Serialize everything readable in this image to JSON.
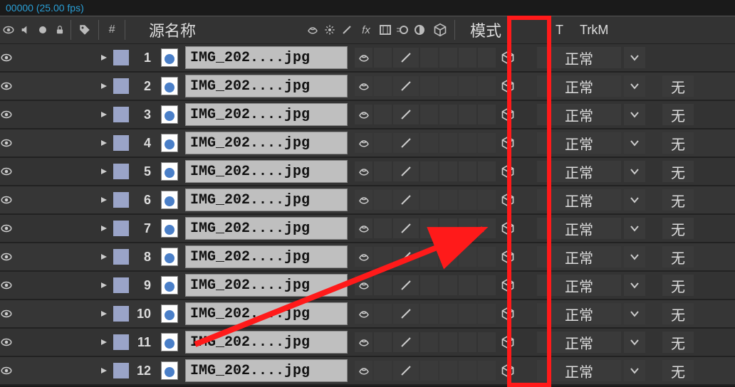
{
  "topbar": {
    "text": "00000 (25.00 fps)"
  },
  "header": {
    "source_name_label": "源名称",
    "mode_label": "模式",
    "t_label": "T",
    "trkmat_label": "TrkM"
  },
  "icons": {
    "eye": "eye-icon",
    "speaker": "speaker-icon",
    "solo": "solo-icon",
    "lock": "lock-icon",
    "label": "label-icon",
    "hash": "hash-icon",
    "shy": "shy-icon",
    "sun": "sun-icon",
    "slash": "slash-icon",
    "fx": "fx-icon",
    "frame": "frame-blend-icon",
    "mb": "motion-blur-icon",
    "adj": "adjustment-icon",
    "cube": "three-d-cube-icon",
    "chevdown": "chevron-down-icon",
    "triangle": "expand-triangle-icon"
  },
  "layers": [
    {
      "num": "1",
      "name": "IMG_202....jpg",
      "mode": "正常",
      "trk": ""
    },
    {
      "num": "2",
      "name": "IMG_202....jpg",
      "mode": "正常",
      "trk": "无"
    },
    {
      "num": "3",
      "name": "IMG_202....jpg",
      "mode": "正常",
      "trk": "无"
    },
    {
      "num": "4",
      "name": "IMG_202....jpg",
      "mode": "正常",
      "trk": "无"
    },
    {
      "num": "5",
      "name": "IMG_202....jpg",
      "mode": "正常",
      "trk": "无"
    },
    {
      "num": "6",
      "name": "IMG_202....jpg",
      "mode": "正常",
      "trk": "无"
    },
    {
      "num": "7",
      "name": "IMG_202....jpg",
      "mode": "正常",
      "trk": "无"
    },
    {
      "num": "8",
      "name": "IMG_202....jpg",
      "mode": "正常",
      "trk": "无"
    },
    {
      "num": "9",
      "name": "IMG_202....jpg",
      "mode": "正常",
      "trk": "无"
    },
    {
      "num": "10",
      "name": "IMG_202....jpg",
      "mode": "正常",
      "trk": "无"
    },
    {
      "num": "11",
      "name": "IMG_202....jpg",
      "mode": "正常",
      "trk": "无"
    },
    {
      "num": "12",
      "name": "IMG_202....jpg",
      "mode": "正常",
      "trk": "无"
    }
  ]
}
